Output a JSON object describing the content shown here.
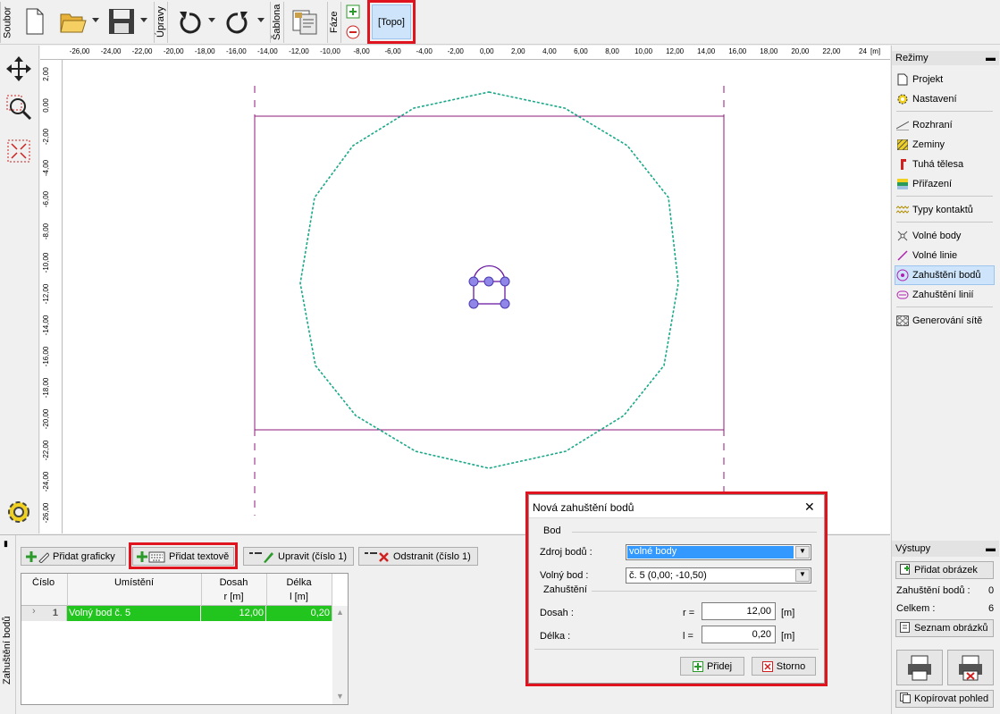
{
  "toolbar": {
    "soubor": "Soubor",
    "upravy": "Úpravy",
    "sablona": "Šablona",
    "faze": "Fáze",
    "topo": "[Topo]"
  },
  "ruler": {
    "top_labels": [
      "-26,00",
      "-24,00",
      "-22,00",
      "-20,00",
      "-18,00",
      "-16,00",
      "-14,00",
      "-12,00",
      "-10,00",
      "-8,00",
      "-6,00",
      "-4,00",
      "-2,00",
      "0,00",
      "2,00",
      "4,00",
      "6,00",
      "8,00",
      "10,00",
      "12,00",
      "14,00",
      "16,00",
      "18,00",
      "20,00",
      "22,00",
      "24"
    ],
    "top_unit": "[m]",
    "left_labels": [
      "2,00",
      "0,00",
      "-2,00",
      "-4,00",
      "-6,00",
      "-8,00",
      "-10,00",
      "-12,00",
      "-14,00",
      "-16,00",
      "-18,00",
      "-20,00",
      "-22,00",
      "-24,00",
      "-26,00"
    ]
  },
  "right_panel": {
    "rezimy": "Režimy",
    "modes": [
      "Projekt",
      "Nastavení",
      "Rozhraní",
      "Zeminy",
      "Tuhá tělesa",
      "Přiřazení",
      "Typy kontaktů",
      "Volné body",
      "Volné linie",
      "Zahuštění bodů",
      "Zahuštění linií",
      "Generování sítě"
    ],
    "vystupy": "Výstupy",
    "pridat_obrazek": "Přidat obrázek",
    "zahusteni_label": "Zahuštění bodů :",
    "zahusteni_value": "0",
    "celkem_label": "Celkem :",
    "celkem_value": "6",
    "seznam_obrazku": "Seznam obrázků",
    "kopirovat_pohled": "Kopírovat pohled"
  },
  "bottom": {
    "side_label": "Zahuštění bodů",
    "add_graphic": "Přidat graficky",
    "add_text": "Přidat textově",
    "edit": "Upravit (číslo 1)",
    "remove": "Odstranit (číslo 1)",
    "columns": {
      "cislo": "Číslo",
      "umisteni": "Umístění",
      "dosah": "Dosah",
      "dosah_unit": "r [m]",
      "delka": "Délka",
      "delka_unit": "l [m]"
    },
    "rows": [
      {
        "num": "1",
        "umisteni": "Volný bod č. 5",
        "dosah": "12,00",
        "delka": "0,20"
      }
    ]
  },
  "dialog": {
    "title": "Nová zahuštění bodů",
    "close": "✕",
    "bod_group": "Bod",
    "zdroj_label": "Zdroj bodů :",
    "zdroj_value": "volné body",
    "volny_label": "Volný bod :",
    "volny_value": "č.  5 (0,00; -10,50)",
    "zah_group": "Zahuštění",
    "dosah_label": "Dosah :",
    "r_label": "r =",
    "dosah_value": "12,00",
    "unit": "[m]",
    "delka_label": "Délka :",
    "l_label": "l =",
    "delka_value": "0,20",
    "pridej": "Přidej",
    "storno": "Storno"
  },
  "colors": {
    "accent_red": "#e0141e",
    "row_green": "#22c41e",
    "region": "#8b1a7a",
    "mesh": "#1aa88a",
    "point": "#7a5fd6"
  }
}
